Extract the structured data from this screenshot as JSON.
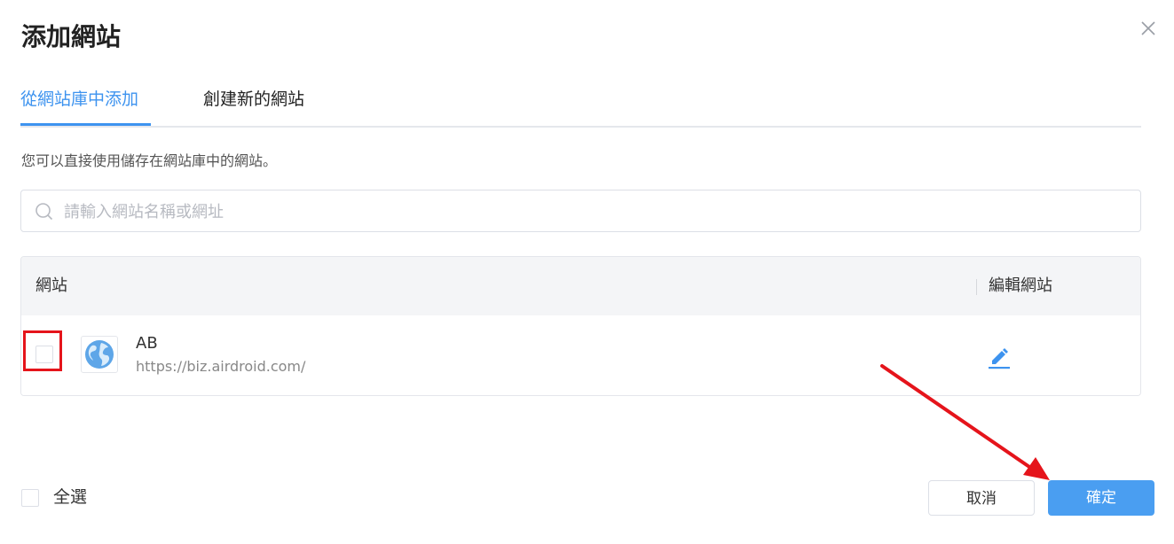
{
  "dialog": {
    "title": "添加網站",
    "close_icon": "close-icon"
  },
  "tabs": [
    {
      "label": "從網站庫中添加",
      "active": true
    },
    {
      "label": "創建新的網站",
      "active": false
    }
  ],
  "description": "您可以直接使用儲存在網站庫中的網站。",
  "search": {
    "placeholder": "請輸入網站名稱或網址",
    "value": "",
    "icon": "search-icon"
  },
  "table": {
    "columns": [
      "網站",
      "編輯網站"
    ],
    "rows": [
      {
        "checked": false,
        "icon": "globe-icon",
        "name": "AB",
        "url": "https://biz.airdroid.com/",
        "edit_icon": "edit-pencil-icon"
      }
    ]
  },
  "annotation": {
    "highlight_color": "#e5141b",
    "arrow_color": "#e5141b"
  },
  "footer": {
    "select_all_label": "全選",
    "select_all_checked": false,
    "cancel_label": "取消",
    "confirm_label": "確定"
  },
  "colors": {
    "accent": "#3d93ef",
    "primary_button": "#4a9ef1"
  }
}
